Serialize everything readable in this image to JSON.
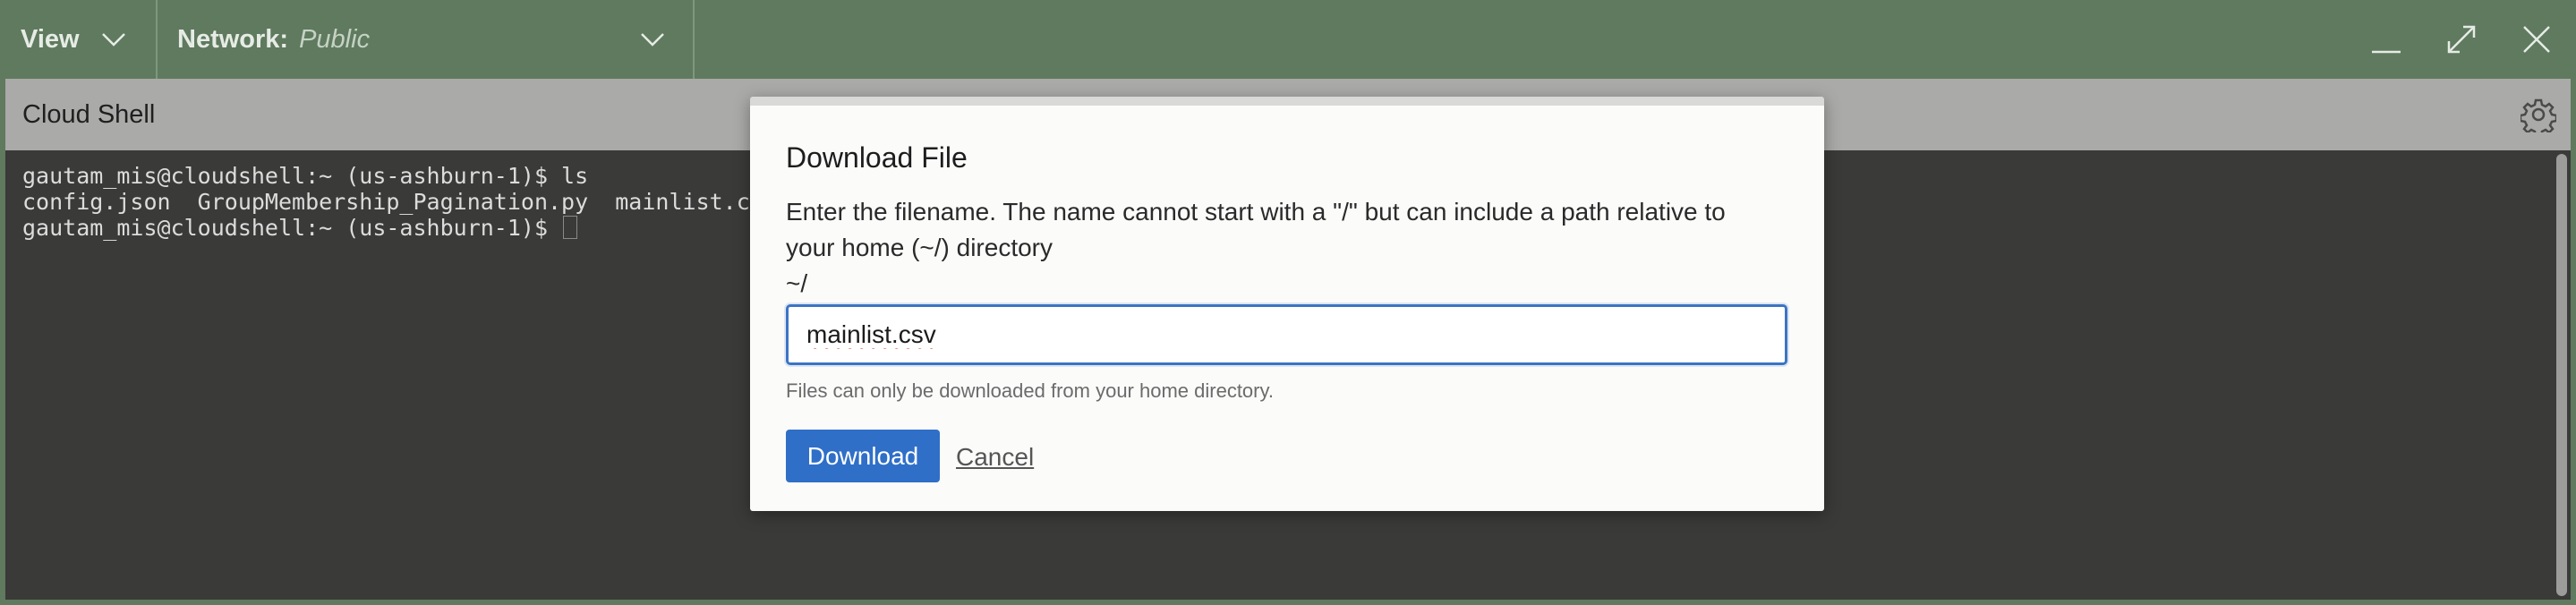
{
  "topbar": {
    "view_label": "View",
    "network_label": "Network:",
    "network_value": "Public"
  },
  "shell": {
    "title": "Cloud Shell"
  },
  "terminal": {
    "lines": [
      "gautam_mis@cloudshell:~ (us-ashburn-1)$ ls",
      "config.json  GroupMembership_Pagination.py  mainlist.csv",
      "gautam_mis@cloudshell:~ (us-ashburn-1)$ "
    ]
  },
  "dialog": {
    "title": "Download File",
    "description": "Enter the filename. The name cannot start with a \"/\" but can include a path relative to your home (~/) directory",
    "prefix": "~/",
    "filename_value": "mainlist.csv",
    "hint": "Files can only be downloaded from your home directory.",
    "download_label": "Download",
    "cancel_label": "Cancel"
  },
  "icons": {
    "chevron": "chevron-down-icon",
    "minimize": "minimize-icon",
    "maximize": "maximize-icon",
    "close": "close-icon",
    "settings": "gear-icon"
  },
  "colors": {
    "topbar_bg": "#5f7a5e",
    "header_bg": "#aaaaa8",
    "terminal_bg": "#3a3a38",
    "primary_button": "#2f6fc8",
    "input_focus": "#3b74c4"
  }
}
